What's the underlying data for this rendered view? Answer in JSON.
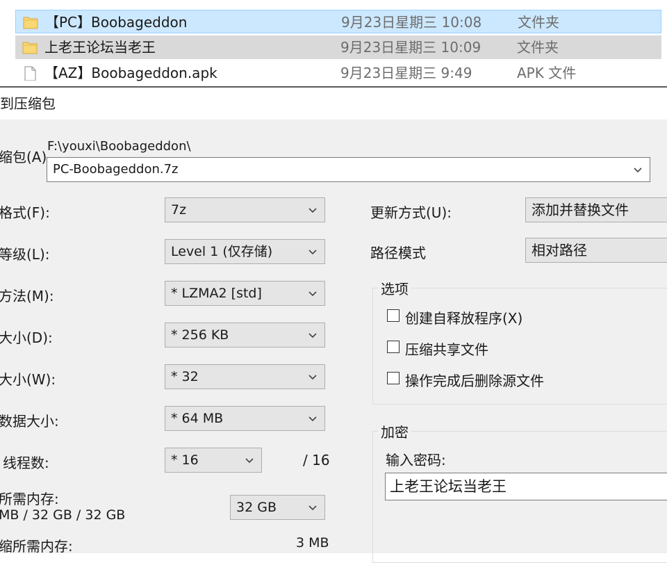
{
  "file_list": {
    "rows": [
      {
        "name": "【PC】Boobageddon",
        "date": "9月23日星期三 10:08",
        "type": "文件夹",
        "icon": "folder-icon"
      },
      {
        "name": "上老王论坛当老王",
        "date": "9月23日星期三 10:09",
        "type": "文件夹",
        "icon": "folder-icon"
      },
      {
        "name": "【AZ】Boobageddon.apk",
        "date": "9月23日星期三 9:49",
        "type": "APK 文件",
        "icon": "file-icon"
      }
    ]
  },
  "dialog": {
    "title": "到压缩包",
    "archive_label": "缩包(A)",
    "archive_path": "F:\\youxi\\Boobageddon\\",
    "archive_name": "PC-Boobageddon.7z",
    "format_label": "格式(F):",
    "format_value": "7z",
    "level_label": "等级(L):",
    "level_value": "Level 1 (仅存储)",
    "method_label": "方法(M):",
    "method_value": "* LZMA2 [std]",
    "dict_label": "大小(D):",
    "dict_value": "* 256 KB",
    "word_label": "大小(W):",
    "word_value": "* 32",
    "solid_label": "数据大小:",
    "solid_value": "* 64 MB",
    "threads_label": "线程数:",
    "threads_value": "* 16",
    "threads_max": "/ 16",
    "mem_compress_label": "所需内存:",
    "mem_compress_value": "MB / 32 GB / 32 GB",
    "mem_limit_value": "32 GB",
    "mem_decompress_label": "缩所需内存:",
    "mem_decompress_value": "3 MB",
    "update_label": "更新方式(U):",
    "update_value": "添加并替换文件",
    "path_mode_label": "路径模式",
    "path_mode_value": "相对路径",
    "options_title": "选项",
    "options": [
      {
        "label": "创建自释放程序(X)",
        "checked": false
      },
      {
        "label": "压缩共享文件",
        "checked": false
      },
      {
        "label": "操作完成后删除源文件",
        "checked": false
      }
    ],
    "encrypt_title": "加密",
    "password_label": "输入密码:",
    "password_value": "上老王论坛当老王"
  },
  "colors": {
    "selection_blue": "#cce8ff",
    "selection_gray": "#d9d9d9",
    "folder_yellow": "#f8d775",
    "dialog_bg": "#f0f0f0"
  }
}
